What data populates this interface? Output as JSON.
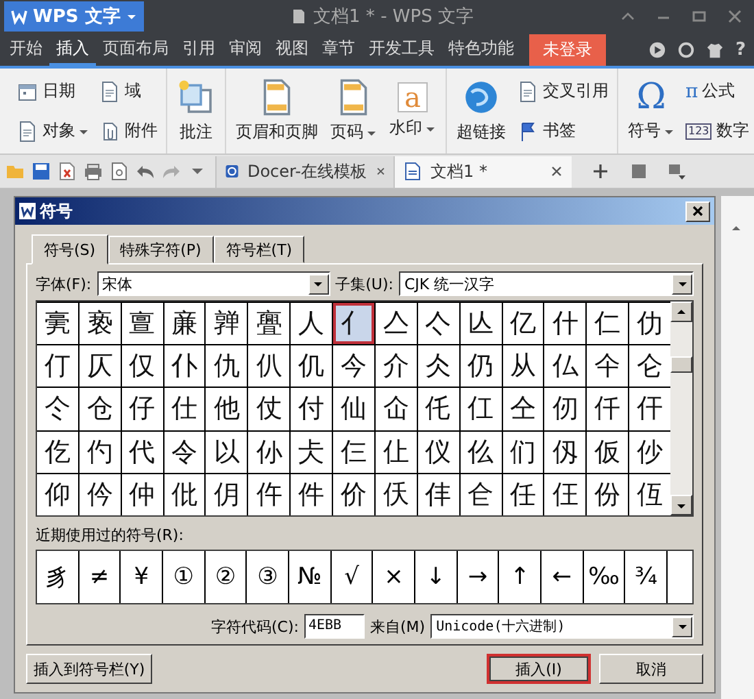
{
  "app": {
    "name": "WPS 文字",
    "title": "文档1 * - WPS 文字",
    "help_glyph": "?"
  },
  "menu": [
    {
      "label": "开始",
      "selected": false
    },
    {
      "label": "插入",
      "selected": true
    },
    {
      "label": "页面布局",
      "selected": false
    },
    {
      "label": "引用",
      "selected": false
    },
    {
      "label": "审阅",
      "selected": false
    },
    {
      "label": "视图",
      "selected": false
    },
    {
      "label": "章节",
      "selected": false
    },
    {
      "label": "开发工具",
      "selected": false
    },
    {
      "label": "特色功能",
      "selected": false
    }
  ],
  "login_button": "未登录",
  "ribbon": [
    {
      "columns": [
        [
          {
            "label": "日期",
            "kind": "small",
            "dropdown": false
          },
          {
            "label": "对象",
            "kind": "small",
            "dropdown": true
          }
        ],
        [
          {
            "label": "域",
            "kind": "small",
            "dropdown": false
          },
          {
            "label": "附件",
            "kind": "small",
            "dropdown": false
          }
        ]
      ]
    },
    {
      "columns": [
        [
          {
            "label": "批注",
            "kind": "large",
            "dropdown": false
          }
        ]
      ]
    },
    {
      "columns": [
        [
          {
            "label": "页眉和页脚",
            "kind": "large",
            "dropdown": false
          }
        ],
        [
          {
            "label": "页码",
            "kind": "large",
            "dropdown": true
          }
        ],
        [
          {
            "label": "水印",
            "kind": "large",
            "dropdown": true,
            "glyph": "a"
          }
        ]
      ]
    },
    {
      "columns": [
        [
          {
            "label": "超链接",
            "kind": "large",
            "dropdown": false
          }
        ],
        [
          {
            "label": "交叉引用",
            "kind": "small",
            "dropdown": false
          },
          {
            "label": "书签",
            "kind": "small",
            "dropdown": false
          }
        ]
      ]
    },
    {
      "columns": [
        [
          {
            "label": "符号",
            "kind": "large",
            "dropdown": true,
            "glyph": "Ω"
          }
        ],
        [
          {
            "label": "公式",
            "kind": "small",
            "dropdown": false,
            "glyph": "π"
          },
          {
            "label": "数字",
            "kind": "small",
            "dropdown": false,
            "glyph": "123"
          }
        ]
      ]
    }
  ],
  "doc_tabs": [
    {
      "label": "Docer-在线模板",
      "selected": false
    },
    {
      "label": "文档1 *",
      "selected": true
    }
  ],
  "dialog": {
    "title": "符号",
    "tabs": [
      {
        "label": "符号(S)",
        "selected": true
      },
      {
        "label": "特殊字符(P)",
        "selected": false
      },
      {
        "label": "符号栏(T)",
        "selected": false
      }
    ],
    "font_label": "字体(F):",
    "font_value": "宋体",
    "subset_label": "子集(U):",
    "subset_value": "CJK 统一汉字",
    "grid": [
      [
        {
          "char": "亴",
          "selected": false
        },
        {
          "char": "亵",
          "selected": false
        },
        {
          "char": "亶",
          "selected": false
        },
        {
          "char": "亷",
          "selected": false
        },
        {
          "char": "亸",
          "selected": false
        },
        {
          "char": "亹",
          "selected": false
        },
        {
          "char": "人",
          "selected": false
        },
        {
          "char": "亻",
          "selected": true
        },
        {
          "char": "亼",
          "selected": false
        },
        {
          "char": "亽",
          "selected": false
        },
        {
          "char": "亾",
          "selected": false
        },
        {
          "char": "亿",
          "selected": false
        },
        {
          "char": "什",
          "selected": false
        },
        {
          "char": "仁",
          "selected": false
        },
        {
          "char": "仂",
          "selected": false
        }
      ],
      [
        {
          "char": "仃",
          "selected": false
        },
        {
          "char": "仄",
          "selected": false
        },
        {
          "char": "仅",
          "selected": false
        },
        {
          "char": "仆",
          "selected": false
        },
        {
          "char": "仇",
          "selected": false
        },
        {
          "char": "仈",
          "selected": false
        },
        {
          "char": "仉",
          "selected": false
        },
        {
          "char": "今",
          "selected": false
        },
        {
          "char": "介",
          "selected": false
        },
        {
          "char": "仌",
          "selected": false
        },
        {
          "char": "仍",
          "selected": false
        },
        {
          "char": "从",
          "selected": false
        },
        {
          "char": "仏",
          "selected": false
        },
        {
          "char": "仐",
          "selected": false
        },
        {
          "char": "仑",
          "selected": false
        }
      ],
      [
        {
          "char": "仒",
          "selected": false
        },
        {
          "char": "仓",
          "selected": false
        },
        {
          "char": "仔",
          "selected": false
        },
        {
          "char": "仕",
          "selected": false
        },
        {
          "char": "他",
          "selected": false
        },
        {
          "char": "仗",
          "selected": false
        },
        {
          "char": "付",
          "selected": false
        },
        {
          "char": "仙",
          "selected": false
        },
        {
          "char": "仚",
          "selected": false
        },
        {
          "char": "仛",
          "selected": false
        },
        {
          "char": "仜",
          "selected": false
        },
        {
          "char": "仝",
          "selected": false
        },
        {
          "char": "仞",
          "selected": false
        },
        {
          "char": "仟",
          "selected": false
        },
        {
          "char": "仠",
          "selected": false
        }
      ],
      [
        {
          "char": "仡",
          "selected": false
        },
        {
          "char": "仢",
          "selected": false
        },
        {
          "char": "代",
          "selected": false
        },
        {
          "char": "令",
          "selected": false
        },
        {
          "char": "以",
          "selected": false
        },
        {
          "char": "仦",
          "selected": false
        },
        {
          "char": "仧",
          "selected": false
        },
        {
          "char": "仨",
          "selected": false
        },
        {
          "char": "仩",
          "selected": false
        },
        {
          "char": "仪",
          "selected": false
        },
        {
          "char": "仫",
          "selected": false
        },
        {
          "char": "们",
          "selected": false
        },
        {
          "char": "仭",
          "selected": false
        },
        {
          "char": "仮",
          "selected": false
        },
        {
          "char": "仯",
          "selected": false
        }
      ],
      [
        {
          "char": "仰",
          "selected": false
        },
        {
          "char": "仱",
          "selected": false
        },
        {
          "char": "仲",
          "selected": false
        },
        {
          "char": "仳",
          "selected": false
        },
        {
          "char": "仴",
          "selected": false
        },
        {
          "char": "仵",
          "selected": false
        },
        {
          "char": "件",
          "selected": false
        },
        {
          "char": "价",
          "selected": false
        },
        {
          "char": "仸",
          "selected": false
        },
        {
          "char": "仹",
          "selected": false
        },
        {
          "char": "仺",
          "selected": false
        },
        {
          "char": "任",
          "selected": false
        },
        {
          "char": "仼",
          "selected": false
        },
        {
          "char": "份",
          "selected": false
        },
        {
          "char": "仾",
          "selected": false
        }
      ]
    ],
    "recent_label": "近期使用过的符号(R):",
    "recent": [
      "豸",
      "≠",
      "¥",
      "①",
      "②",
      "③",
      "№",
      "√",
      "×",
      "↓",
      "→",
      "↑",
      "←",
      "‰",
      "¾"
    ],
    "code_label": "字符代码(C):",
    "code_value": "4EBB",
    "from_label": "来自(M)",
    "from_value": "Unicode(十六进制)",
    "buttons": [
      {
        "label": "插入到符号栏(Y)",
        "highlighted": false
      },
      {
        "label": "插入(I)",
        "highlighted": true
      },
      {
        "label": "取消",
        "highlighted": false
      }
    ]
  }
}
